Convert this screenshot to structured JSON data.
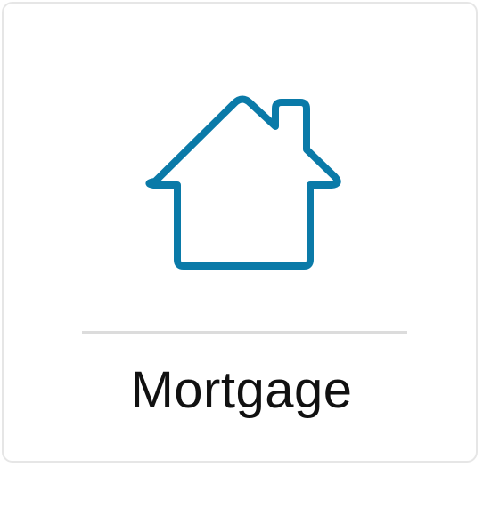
{
  "tile": {
    "label": "Mortgage",
    "icon": "house-icon",
    "accent_color": "#0a7aa8"
  }
}
